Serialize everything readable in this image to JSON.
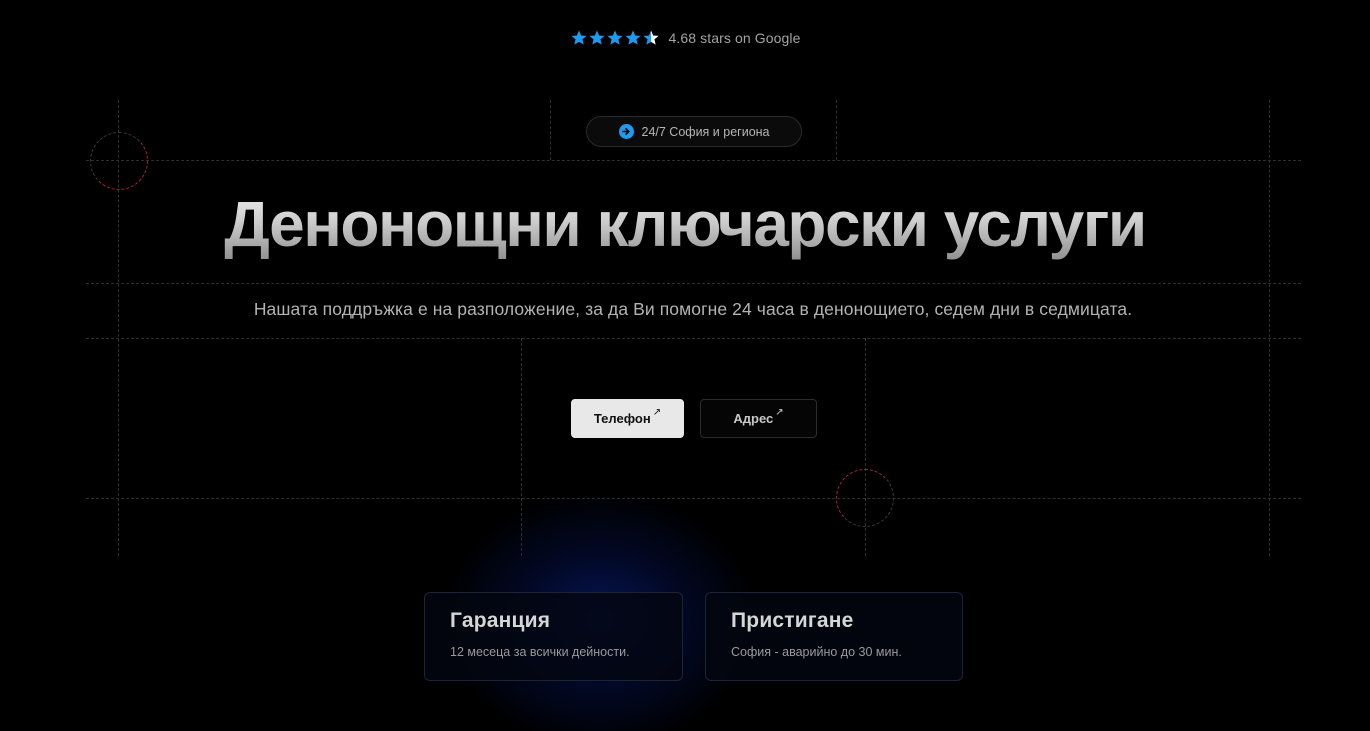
{
  "rating": {
    "stars": 4.68,
    "text": "4.68 stars on Google",
    "star_color": "#1d9bf0"
  },
  "badge": {
    "icon": "arrow-right-circle-icon",
    "text": "24/7 София и региона"
  },
  "hero": {
    "title": "Денонощни ключарски услуги",
    "subtitle": "Нашата поддръжка е на разположение, за да Ви помогне 24 часа в денонощието, седем дни в седмицата."
  },
  "buttons": {
    "phone_label": "Телефон",
    "address_label": "Адрес",
    "arrow": "↗"
  },
  "cards": [
    {
      "title": "Гаранция",
      "text": "12 месеца за всички дейности."
    },
    {
      "title": "Пристигане",
      "text": "София - аварийно до 30 мин."
    }
  ],
  "colors": {
    "background": "#000000",
    "accent": "#1d9bf0",
    "grid": "#2f2f2f",
    "deco_red": "#b0223a",
    "glow": "#0a28a0"
  }
}
